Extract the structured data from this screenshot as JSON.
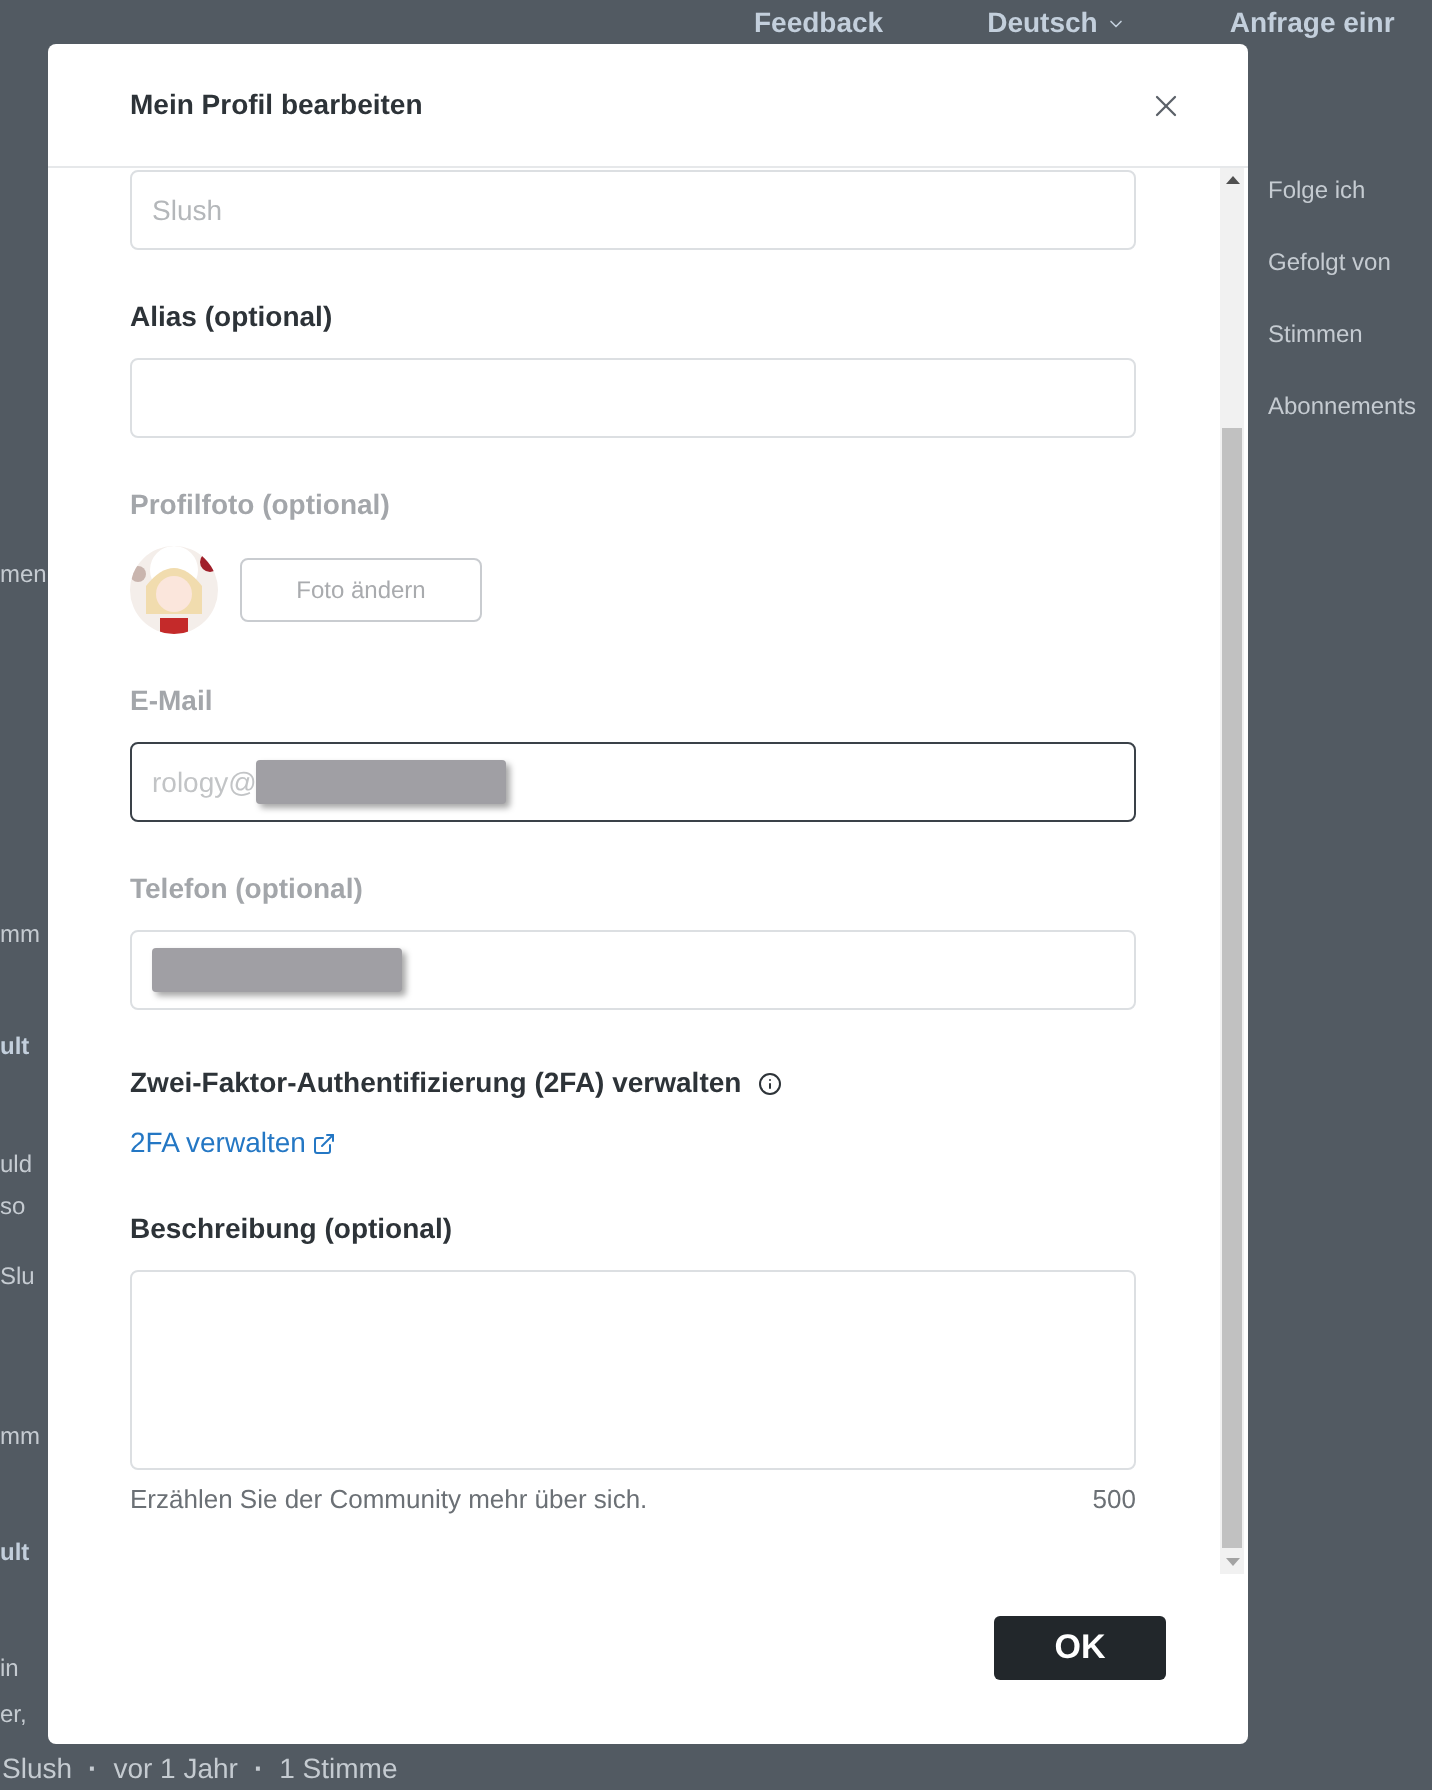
{
  "background": {
    "nav_links": [
      "Feedback",
      "Deutsch",
      "Anfrage einr"
    ],
    "separator": "·",
    "sidebar_items": [
      "Folge ich",
      "Gefolgt von",
      "Stimmen",
      "Abonnements"
    ],
    "fragments": [
      {
        "text": "men",
        "kind": "plain"
      },
      {
        "text": "mm",
        "kind": "plain"
      },
      {
        "text": "ult",
        "kind": "title"
      },
      {
        "text": "uld",
        "kind": "plain"
      },
      {
        "text": "so",
        "kind": "plain"
      },
      {
        "text": "Slu",
        "kind": "plain"
      },
      {
        "text": "mm",
        "kind": "plain"
      },
      {
        "text": "ult",
        "kind": "title"
      },
      {
        "text": "in",
        "kind": "plain"
      },
      {
        "text": "er,",
        "kind": "plain"
      }
    ],
    "meta": [
      "Slush",
      "vor 1 Jahr",
      "1 Stimme"
    ]
  },
  "dialog": {
    "title": "Mein Profil bearbeiten",
    "fields": [
      {
        "kind": "input",
        "placeholder": "Slush",
        "disabled": false,
        "focused": false
      },
      {
        "kind": "input",
        "label": "Alias (optional)",
        "disabled": false,
        "focused": false
      },
      {
        "label": "Profilfoto (optional)",
        "button": "Foto ändern",
        "disabled": true
      },
      {
        "kind": "input",
        "label": "E-Mail",
        "value": "rology@",
        "redacted": true,
        "disabled": true,
        "focused": true
      },
      {
        "kind": "input",
        "label": "Telefon (optional)",
        "redacted": true,
        "disabled": true,
        "focused": false
      },
      {
        "kind": "link",
        "label": "Zwei-Faktor-Authentifizierung (2FA) verwalten",
        "link": "2FA verwalten"
      },
      {
        "kind": "textarea",
        "label": "Beschreibung (optional)",
        "hint": "Erzählen Sie der Community mehr über sich.",
        "counter": "500"
      }
    ],
    "ok_button": "OK"
  }
}
